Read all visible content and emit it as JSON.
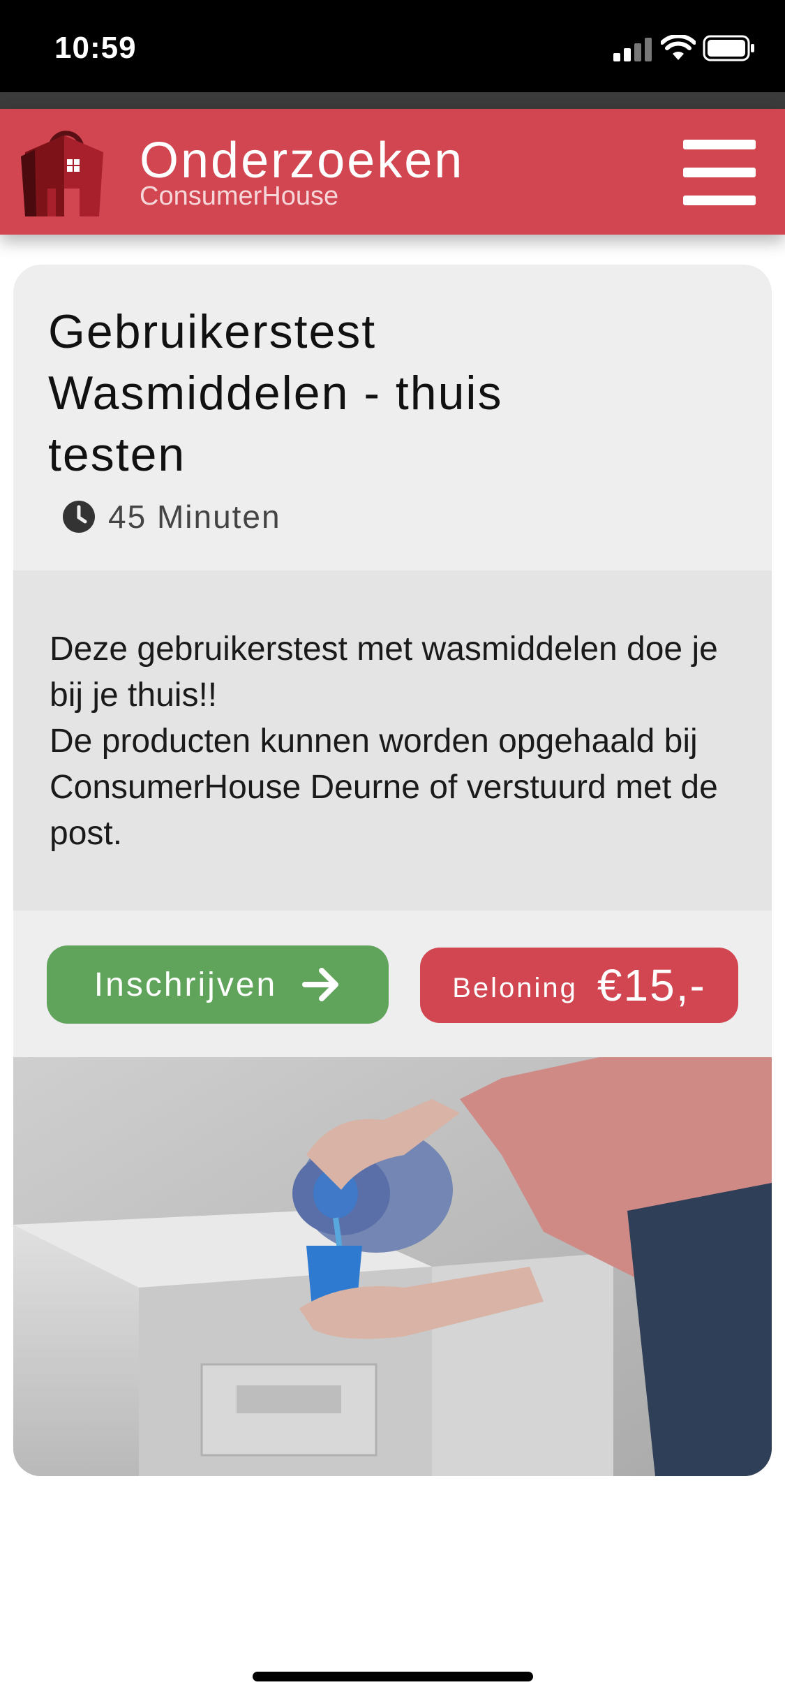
{
  "status_bar": {
    "time": "10:59",
    "icons": [
      "cellular-signal-icon",
      "wifi-icon",
      "battery-icon"
    ]
  },
  "header": {
    "title": "Onderzoeken",
    "subtitle": "ConsumerHouse",
    "logo": "consumerhouse-logo-icon",
    "menu_icon": "hamburger-menu-icon",
    "background_color": "#d14650"
  },
  "card": {
    "title": "Gebruikerstest Wasmiddelen - thuis testen",
    "duration_icon": "clock-icon",
    "duration": "45 Minuten",
    "description": "Deze gebruikerstest met wasmiddelen doe je bij je thuis!!\nDe producten kunnen worden opgehaald bij ConsumerHouse Deurne of verstuurd met de post.",
    "signup_button": {
      "label": "Inschrijven",
      "icon": "arrow-right-icon",
      "color": "#5fa45a"
    },
    "reward": {
      "label": "Beloning",
      "amount": "€15,-",
      "color": "#d14650"
    },
    "image": "detergent-being-poured-into-cap-above-washing-machine"
  }
}
